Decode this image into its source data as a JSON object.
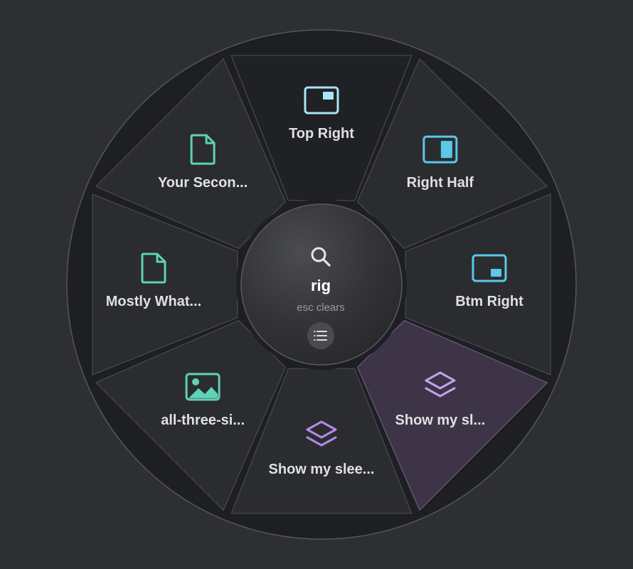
{
  "menu": {
    "center": {
      "query": "rig",
      "hint": "esc clears",
      "search_icon": "search-icon",
      "list_icon": "list-icon"
    },
    "segments": [
      {
        "id": "top-right",
        "label": "Top Right",
        "icon": "window-top-right-icon",
        "color": "#a9e4f7",
        "highlighted": false
      },
      {
        "id": "right-half",
        "label": "Right Half",
        "icon": "window-right-half-icon",
        "color": "#5ac8e8",
        "highlighted": false
      },
      {
        "id": "btm-right",
        "label": "Btm Right",
        "icon": "window-bottom-right-icon",
        "color": "#5ac8e8",
        "highlighted": false
      },
      {
        "id": "show-my-sl",
        "label": "Show my sl...",
        "icon": "layers-icon",
        "color": "#c7a3f0",
        "highlighted": true
      },
      {
        "id": "show-my-slee",
        "label": "Show my slee...",
        "icon": "layers-icon",
        "color": "#b08ae8",
        "highlighted": false
      },
      {
        "id": "all-three",
        "label": "all-three-si...",
        "icon": "image-icon",
        "color": "#5fd1b5",
        "highlighted": false
      },
      {
        "id": "mostly-what",
        "label": "Mostly What...",
        "icon": "file-icon",
        "color": "#5fd1b5",
        "highlighted": false
      },
      {
        "id": "your-secon",
        "label": "Your Secon...",
        "icon": "file-icon",
        "color": "#5fd1b5",
        "highlighted": false
      }
    ],
    "colors": {
      "segment_fill": "#2b2c30",
      "segment_top_fill": "#202124",
      "segment_highlight_fill": "#3e3448",
      "ring_fill": "#1e1f22"
    }
  }
}
